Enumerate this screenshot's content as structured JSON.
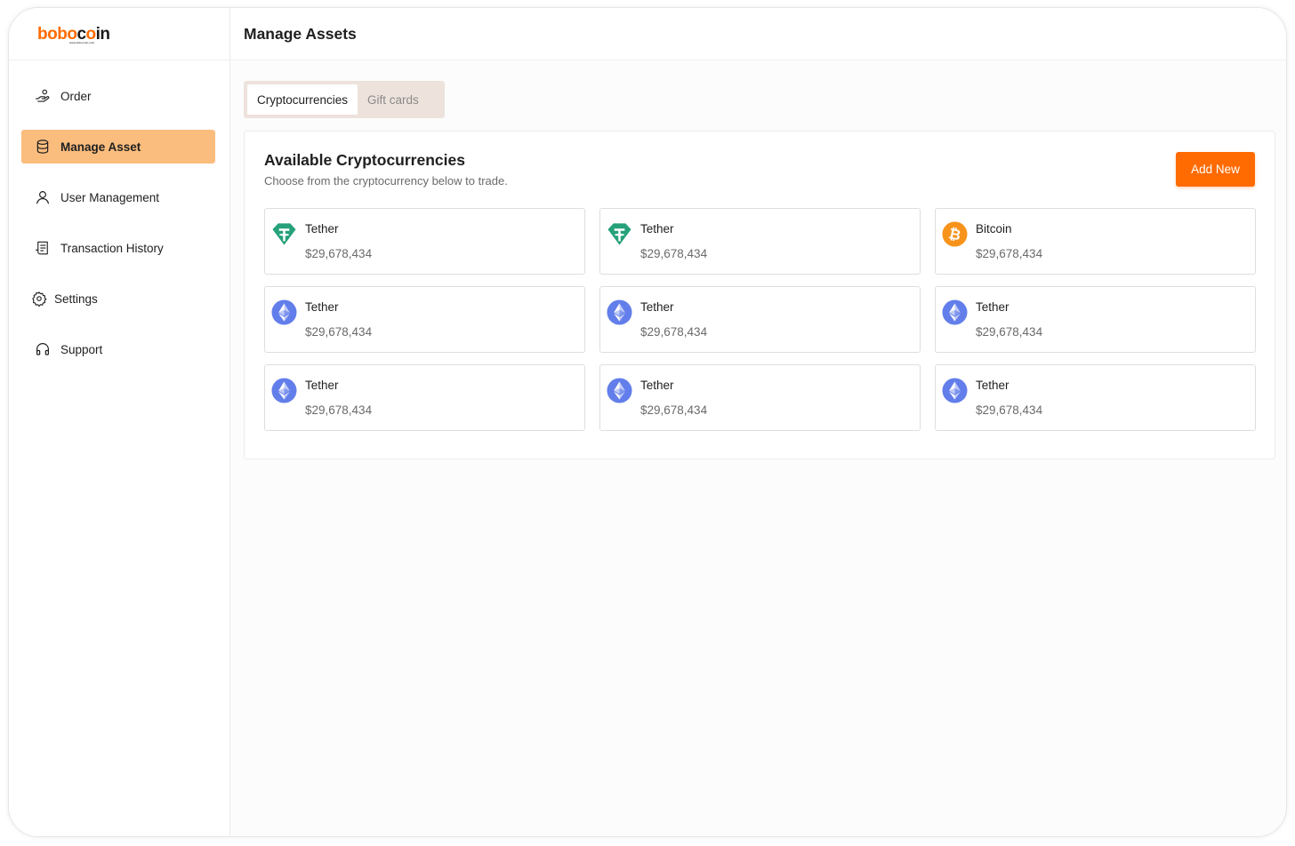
{
  "brand": {
    "logo_part1": "bobo",
    "logo_part2": "c",
    "logo_part3": "o",
    "logo_part4": "in",
    "tagline": "www.bobocoin.com",
    "accent_color": "#ff6b00",
    "active_nav_color": "#fbbd7e"
  },
  "sidebar": {
    "items": [
      {
        "label": "Order",
        "icon": "hand-coin-icon",
        "active": false
      },
      {
        "label": "Manage Asset",
        "icon": "database-icon",
        "active": true
      },
      {
        "label": "User Management",
        "icon": "user-icon",
        "active": false
      },
      {
        "label": "Transaction History",
        "icon": "receipt-icon",
        "active": false
      },
      {
        "label": "Settings",
        "icon": "gear-icon",
        "active": false
      },
      {
        "label": "Support",
        "icon": "headset-icon",
        "active": false
      }
    ]
  },
  "header": {
    "title": "Manage Assets"
  },
  "tabs": [
    {
      "label": "Cryptocurrencies",
      "active": true
    },
    {
      "label": "Gift cards",
      "active": false
    }
  ],
  "panel": {
    "title": "Available Cryptocurrencies",
    "subtitle": "Choose from the cryptocurrency below to trade.",
    "add_button": "Add New"
  },
  "assets": [
    {
      "name": "Tether",
      "price": "$29,678,434",
      "icon": "tether-icon"
    },
    {
      "name": "Tether",
      "price": "$29,678,434",
      "icon": "tether-icon"
    },
    {
      "name": "Bitcoin",
      "price": "$29,678,434",
      "icon": "bitcoin-icon"
    },
    {
      "name": "Tether",
      "price": "$29,678,434",
      "icon": "ethereum-icon"
    },
    {
      "name": "Tether",
      "price": "$29,678,434",
      "icon": "ethereum-icon"
    },
    {
      "name": "Tether",
      "price": "$29,678,434",
      "icon": "ethereum-icon"
    },
    {
      "name": "Tether",
      "price": "$29,678,434",
      "icon": "ethereum-icon"
    },
    {
      "name": "Tether",
      "price": "$29,678,434",
      "icon": "ethereum-icon"
    },
    {
      "name": "Tether",
      "price": "$29,678,434",
      "icon": "ethereum-icon"
    }
  ]
}
